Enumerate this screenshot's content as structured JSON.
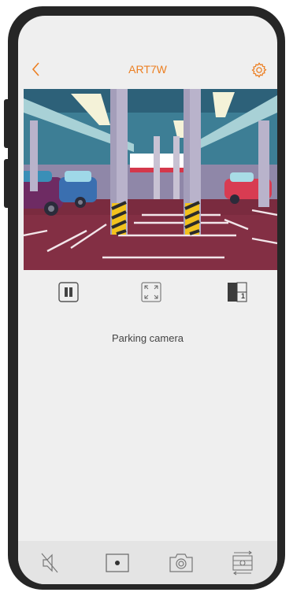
{
  "header": {
    "title": "ART7W"
  },
  "camera": {
    "name": "Parking camera"
  },
  "controls": {
    "grid_count": "1"
  },
  "colors": {
    "accent": "#ec7f22",
    "frame": "#262626",
    "screen_bg": "#efefef",
    "bottom_bar": "#e4e4e4"
  },
  "icons": {
    "back": "chevron-left-icon",
    "settings": "gear-icon",
    "pause": "pause-icon",
    "fullscreen": "fullscreen-icon",
    "grid": "grid-icon",
    "mute": "speaker-muted-icon",
    "record": "record-icon",
    "snapshot": "camera-icon",
    "switch": "switch-camera-icon"
  }
}
